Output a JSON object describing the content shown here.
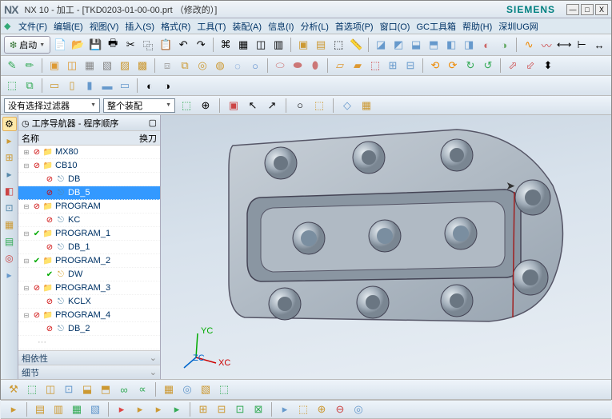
{
  "title": {
    "app": "NX",
    "full": "NX 10 - 加工 - [TKD0203-01-00-00.prt （修改的）]",
    "brand": "SIEMENS"
  },
  "menu": [
    "文件(F)",
    "编辑(E)",
    "视图(V)",
    "插入(S)",
    "格式(R)",
    "工具(T)",
    "装配(A)",
    "信息(I)",
    "分析(L)",
    "首选项(P)",
    "窗口(O)",
    "GC工具箱",
    "帮助(H)",
    "深圳UG网"
  ],
  "start_label": "启动",
  "filter": {
    "no_sel": "没有选择过滤器",
    "assy": "整个装配"
  },
  "nav": {
    "title": "工序导航器 - 程序顺序",
    "cols": {
      "name": "名称",
      "tool": "换刀"
    },
    "footers": {
      "dep": "相依性",
      "detail": "细节"
    },
    "tree": [
      {
        "lvl": 0,
        "exp": "+",
        "stat": "block",
        "type": "folder",
        "label": "MX80"
      },
      {
        "lvl": 0,
        "exp": "-",
        "stat": "block",
        "type": "folder",
        "label": "CB10"
      },
      {
        "lvl": 1,
        "exp": "",
        "stat": "block",
        "type": "op",
        "label": "DB"
      },
      {
        "lvl": 1,
        "exp": "",
        "stat": "block",
        "type": "op",
        "label": "DB_5",
        "sel": true
      },
      {
        "lvl": 0,
        "exp": "-",
        "stat": "block",
        "type": "folder",
        "label": "PROGRAM"
      },
      {
        "lvl": 1,
        "exp": "",
        "stat": "block",
        "type": "op",
        "label": "KC"
      },
      {
        "lvl": 0,
        "exp": "-",
        "stat": "check",
        "type": "folder",
        "label": "PROGRAM_1",
        "trail": "···"
      },
      {
        "lvl": 1,
        "exp": "",
        "stat": "block",
        "type": "op",
        "label": "DB_1"
      },
      {
        "lvl": 0,
        "exp": "-",
        "stat": "check",
        "type": "folder",
        "label": "PROGRAM_2",
        "trail": "···"
      },
      {
        "lvl": 1,
        "exp": "",
        "stat": "check",
        "type": "opy",
        "label": "DW"
      },
      {
        "lvl": 0,
        "exp": "-",
        "stat": "block",
        "type": "folder",
        "label": "PROGRAM_3",
        "trail": "···"
      },
      {
        "lvl": 1,
        "exp": "",
        "stat": "block",
        "type": "op",
        "label": "KCLX"
      },
      {
        "lvl": 0,
        "exp": "-",
        "stat": "block",
        "type": "folder",
        "label": "PROGRAM_4",
        "trail": "···"
      },
      {
        "lvl": 1,
        "exp": "",
        "stat": "block",
        "type": "op",
        "label": "DB_2"
      }
    ]
  },
  "axes": {
    "x": "XC",
    "y": "YC",
    "z": "ZC"
  }
}
